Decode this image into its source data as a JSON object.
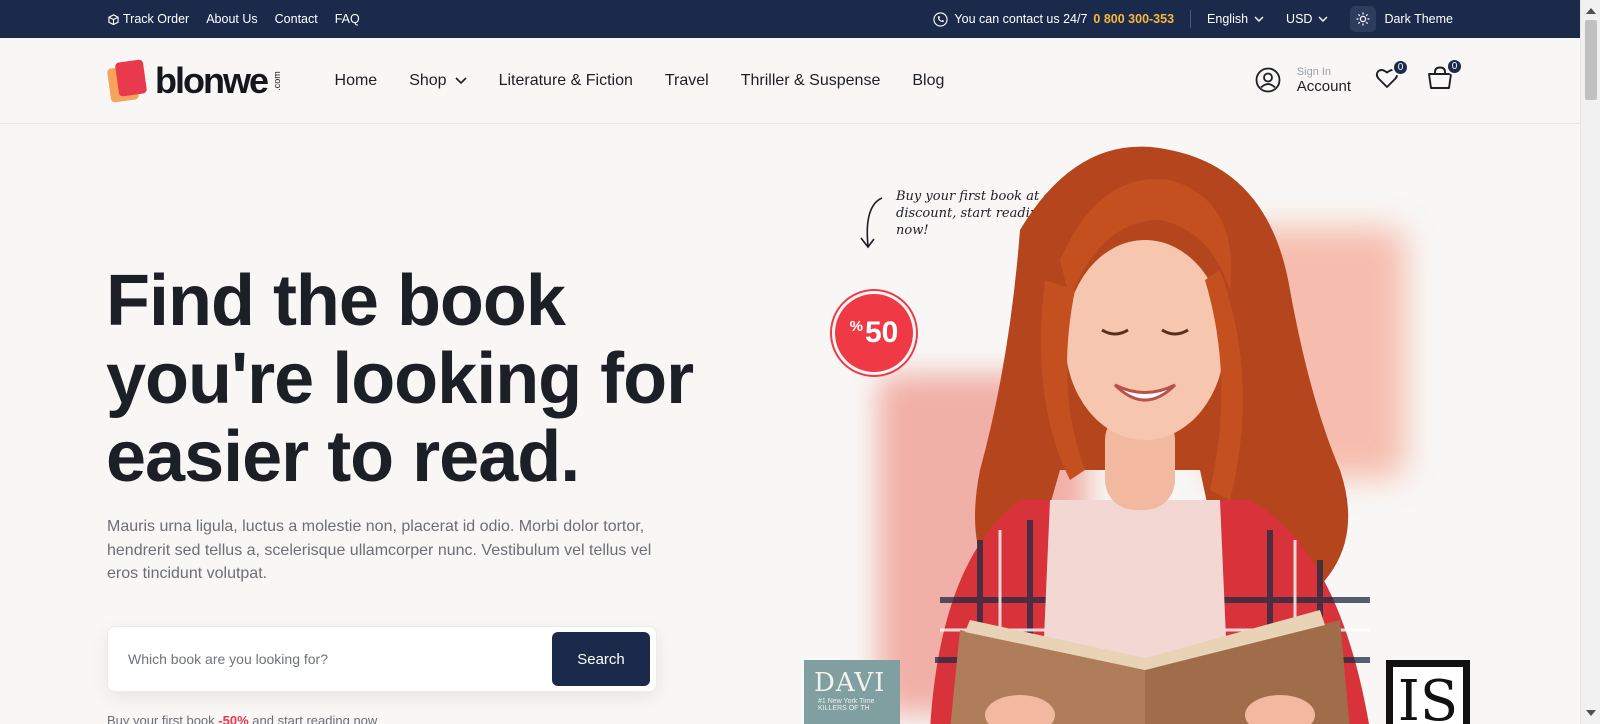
{
  "topbar": {
    "links": [
      {
        "label": "Track Order",
        "icon": "box-icon"
      },
      {
        "label": "About Us"
      },
      {
        "label": "Contact"
      },
      {
        "label": "FAQ"
      }
    ],
    "contact_text": "You can contact us 24/7",
    "phone": "0 800 300-353",
    "language": "English",
    "currency": "USD",
    "theme_label": "Dark Theme"
  },
  "header": {
    "logo_text": "blonwe",
    "logo_suffix": ".com",
    "nav": [
      {
        "label": "Home"
      },
      {
        "label": "Shop",
        "has_dropdown": true
      },
      {
        "label": "Literature & Fiction"
      },
      {
        "label": "Travel"
      },
      {
        "label": "Thriller & Suspense"
      },
      {
        "label": "Blog"
      }
    ],
    "account_small": "Sign In",
    "account_big": "Account",
    "wishlist_count": "0",
    "cart_count": "0"
  },
  "hero": {
    "title_lines": [
      "Find the book",
      "you're looking for",
      "easier to read."
    ],
    "description": "Mauris urna ligula, luctus a molestie non, placerat id odio. Morbi dolor tortor, hendrerit sed tellus a, scelerisque ullamcorper nunc. Vestibulum vel tellus vel eros tincidunt volutpat.",
    "search_placeholder": "Which book are you looking for?",
    "search_button": "Search",
    "promo_prefix": "Buy your first book",
    "promo_highlight": "-50%",
    "promo_suffix": "and start reading now",
    "annotation": "Buy your first book at a discount, start reading now!",
    "badge_symbol": "%",
    "badge_value": "50",
    "book_left_title": "DAVI",
    "book_left_sub1": "#1 New York Time",
    "book_left_sub2": "KILLERS OF TH",
    "book_right_title": "IS"
  },
  "colors": {
    "navy": "#1b2a4a",
    "accent_red": "#ef3a46",
    "phone_yellow": "#f5b83d",
    "background": "#f8f7f5"
  }
}
